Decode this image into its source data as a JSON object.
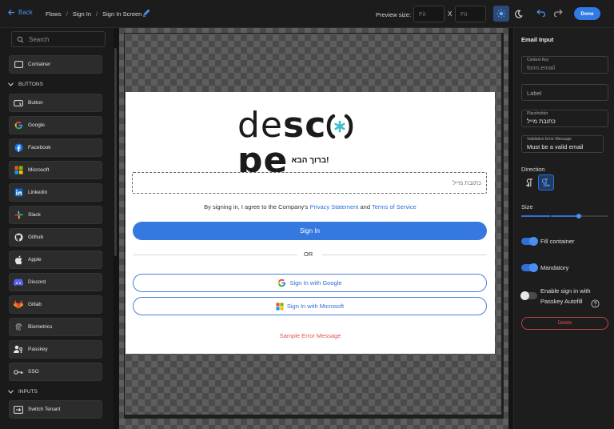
{
  "topbar": {
    "back_label": "Back",
    "breadcrumbs": [
      "Flows",
      "Sign In",
      "Sign In Screen"
    ],
    "breadcrumb_separator": "/",
    "preview_label": "Preview size:",
    "width_placeholder": "Fit",
    "height_placeholder": "Fit",
    "x_separator": "X",
    "done_label": "Done"
  },
  "sidebar": {
    "search_placeholder": "Search",
    "container_label": "Container",
    "buttons_section": "BUTTONS",
    "buttons": [
      {
        "label": "Button",
        "icon": "button-icon"
      },
      {
        "label": "Google",
        "icon": "google-icon"
      },
      {
        "label": "Facebook",
        "icon": "facebook-icon"
      },
      {
        "label": "Microsoft",
        "icon": "microsoft-icon"
      },
      {
        "label": "Linkedin",
        "icon": "linkedin-icon"
      },
      {
        "label": "Slack",
        "icon": "slack-icon"
      },
      {
        "label": "Github",
        "icon": "github-icon"
      },
      {
        "label": "Apple",
        "icon": "apple-icon"
      },
      {
        "label": "Discord",
        "icon": "discord-icon"
      },
      {
        "label": "Gitlab",
        "icon": "gitlab-icon"
      },
      {
        "label": "Biometrics",
        "icon": "fingerprint-icon"
      },
      {
        "label": "Passkey",
        "icon": "passkey-icon"
      },
      {
        "label": "SSO",
        "icon": "key-icon"
      }
    ],
    "inputs_section": "INPUTS",
    "inputs": [
      {
        "label": "Switch Tenant",
        "icon": "switch-tenant-icon"
      }
    ]
  },
  "preview": {
    "logo_text_light": "de",
    "logo_text_bold_1": "sc",
    "logo_text_bold_2": "pe",
    "welcome": "ברוך הבא!",
    "email_placeholder": "כתובת מייל",
    "agree_prefix": "By signing in, I agree to the Company's",
    "privacy_link": "Privacy Statement",
    "and_text": "and",
    "terms_link": "Terms of Service",
    "sign_in_label": "Sign In",
    "or_label": "OR",
    "google_label": "Sign In with Google",
    "microsoft_label": "Sign In with Microsoft",
    "error_message": "Sample Error Message"
  },
  "panel": {
    "title": "Email Input",
    "context_key_label": "Context Key",
    "context_key_value": "form.email",
    "label_placeholder": "Label",
    "placeholder_label": "Placeholder",
    "placeholder_value": "כתובת מייל",
    "validation_label": "Validation Error Message",
    "validation_value": "Must be a valid email",
    "direction_label": "Direction",
    "size_label": "Size",
    "size_value_fraction": 0.66,
    "fill_container_label": "Fill container",
    "fill_container_on": true,
    "mandatory_label": "Mandatory",
    "mandatory_on": true,
    "passkey_label_1": "Enable sign in with",
    "passkey_label_2": "Passkey Autofill",
    "passkey_on": false,
    "delete_label": "Delete"
  },
  "colors": {
    "accent": "#2f7ae5",
    "danger": "#e05252",
    "link": "#2f6fd6"
  }
}
